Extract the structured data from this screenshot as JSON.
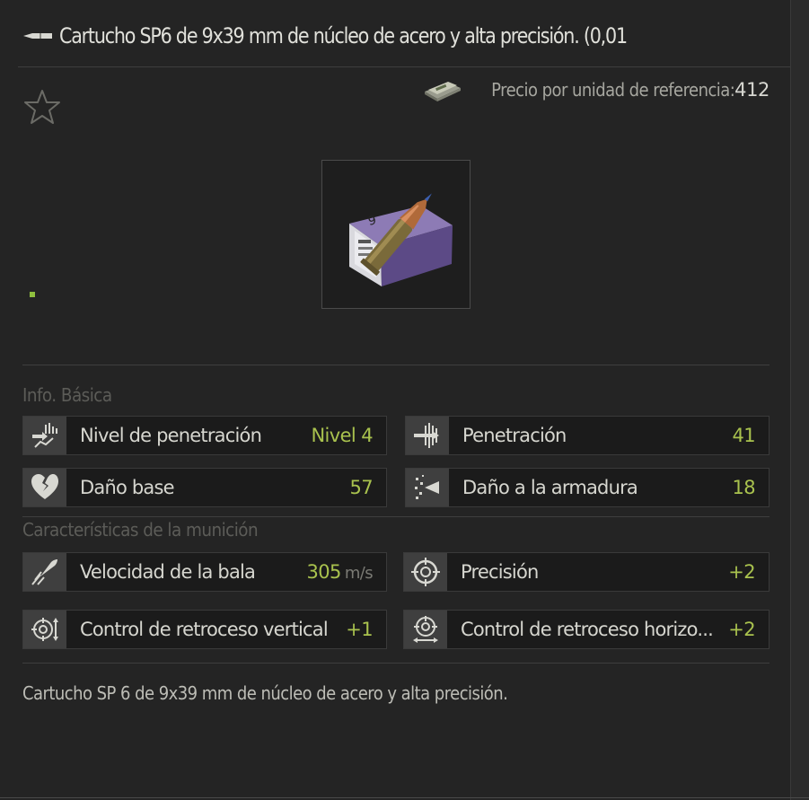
{
  "item": {
    "title": "Cartucho SP6 de 9x39 mm de núcleo de acero y alta precisión. (0,01",
    "title_icon": "bullet-icon",
    "price_label": "Precio por unidad de referencia:",
    "price_value": "412",
    "price_icon": "money-stack-icon",
    "favorite_icon": "star-icon",
    "image_icon": "ammo-box-icon"
  },
  "sections": {
    "basic_info": "Info. Básica",
    "ammo_characteristics": "Características de la munición"
  },
  "stats": {
    "penetration_level": {
      "label": "Nivel de penetración",
      "value": "Nivel 4",
      "icon": "penetration-level-icon"
    },
    "penetration": {
      "label": "Penetración",
      "value": "41",
      "icon": "penetration-icon"
    },
    "base_damage": {
      "label": "Daño base",
      "value": "57",
      "icon": "broken-heart-icon"
    },
    "armor_damage": {
      "label": "Daño a la armadura",
      "value": "18",
      "icon": "armor-damage-icon"
    },
    "bullet_velocity": {
      "label": "Velocidad de la bala",
      "value": "305",
      "unit": "m/s",
      "icon": "bullet-velocity-icon"
    },
    "accuracy": {
      "label": "Precisión",
      "value": "+2",
      "icon": "crosshair-icon"
    },
    "vertical_recoil": {
      "label": "Control de retroceso vertical",
      "value": "+1",
      "icon": "vertical-recoil-icon"
    },
    "horizontal_recoil": {
      "label": "Control de retroceso horizo...",
      "value": "+2",
      "icon": "horizontal-recoil-icon"
    }
  },
  "description": "Cartucho SP 6 de 9x39 mm de núcleo de acero y alta precisión.",
  "colors": {
    "background": "#242424",
    "value_green": "#a9c24e",
    "icon_box": "#3f3f3f"
  }
}
